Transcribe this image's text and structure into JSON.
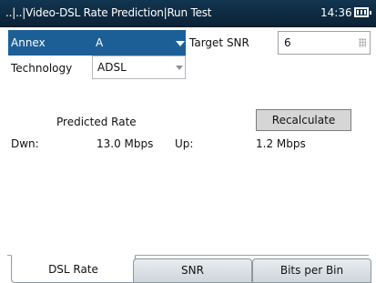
{
  "titlebar": {
    "title": "..|..|Video-DSL Rate Prediction|Run Test",
    "time": "14:36",
    "battery_icon": "battery-icon"
  },
  "form": {
    "annex_label": "Annex",
    "annex_value": "A",
    "target_snr_label": "Target SNR",
    "target_snr_value": "6",
    "technology_label": "Technology",
    "technology_value": "ADSL"
  },
  "prediction": {
    "title": "Predicted Rate",
    "recalculate_label": "Recalculate",
    "down_label": "Dwn:",
    "down_value": "13.0 Mbps",
    "up_label": "Up:",
    "up_value": "1.2 Mbps"
  },
  "tabs": [
    {
      "label": "DSL Rate",
      "active": true
    },
    {
      "label": "SNR",
      "active": false
    },
    {
      "label": "Bits per Bin",
      "active": false
    }
  ],
  "colors": {
    "titlebar": "#0b2236",
    "selected_row": "#1c5f96",
    "button": "#d6d6d6"
  }
}
